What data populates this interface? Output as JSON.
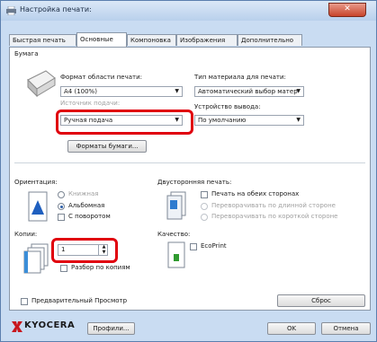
{
  "window": {
    "title": "Настройка печати: ",
    "close_glyph": "✕"
  },
  "tabs": [
    "Быстрая печать",
    "Основные",
    "Компоновка",
    "Изображения",
    "Дополнительно"
  ],
  "paper": {
    "group_label": "Бумага",
    "page_size_label": "Формат области печати:",
    "page_size_value": "A4 (100%)",
    "media_type_label": "Тип материала для печати:",
    "media_type_value": "Автоматический выбор матер",
    "source_label": "Источник подачи:",
    "source_value": "Ручная подача",
    "output_label": "Устройство вывода:",
    "output_value": "По умолчанию",
    "paper_sizes_button": "Форматы бумаги..."
  },
  "orientation": {
    "label": "Ориентация:",
    "portrait": "Книжная",
    "landscape": "Альбомная",
    "rotated": "С поворотом"
  },
  "duplex": {
    "label": "Двусторонняя печать:",
    "both_sides": "Печать на обеих сторонах",
    "flip_long": "Переворачивать по длинной стороне",
    "flip_short": "Переворачивать по короткой стороне"
  },
  "copies": {
    "label": "Копии:",
    "value": "1",
    "collate": "Разбор по копиям"
  },
  "quality": {
    "label": "Качество:",
    "ecoprint": "EcoPrint"
  },
  "preview": {
    "label": "Предварительный Просмотр"
  },
  "reset_button": "Сброс",
  "footer": {
    "brand": "KYOCERA",
    "profiles_button": "Профили...",
    "ok_button": "OK",
    "cancel_button": "Отмена"
  },
  "colors": {
    "highlight": "#e0000d",
    "brand": "#c8161d",
    "titlebar": "#c9dcf2"
  }
}
